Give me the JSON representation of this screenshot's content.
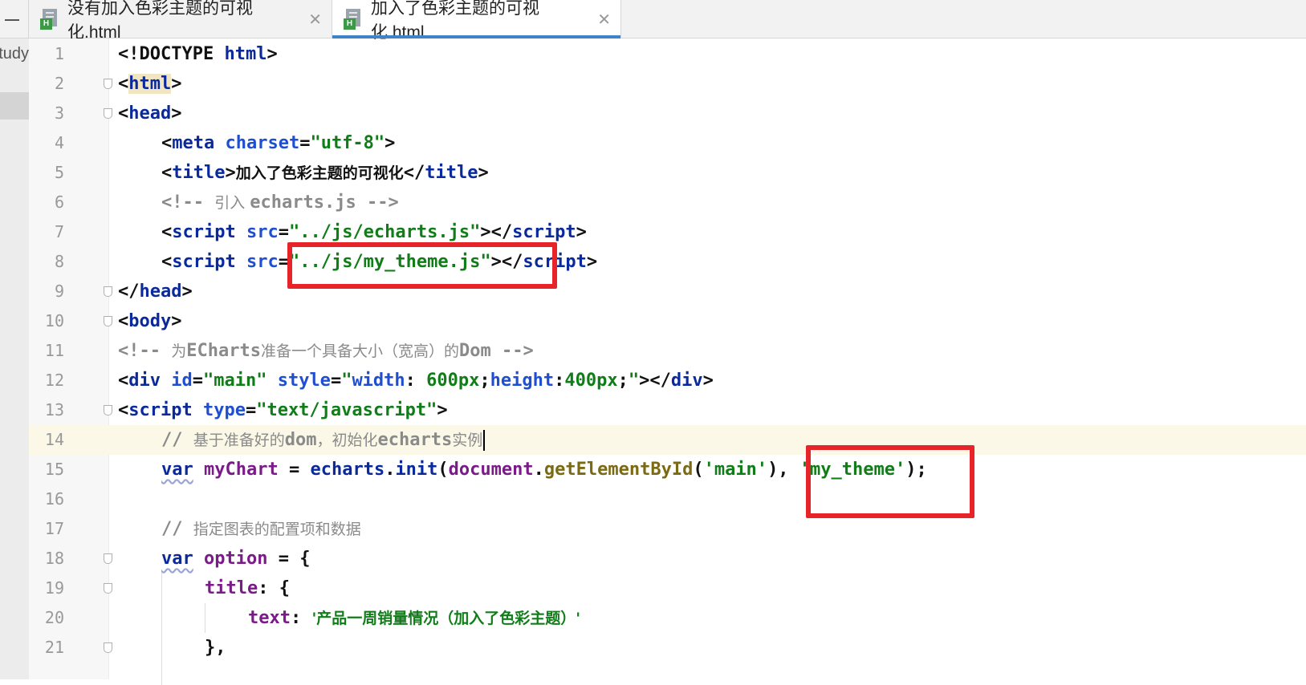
{
  "tabs": [
    {
      "label": "没有加入色彩主题的可视化.html",
      "close": "✕",
      "active": false,
      "icon": "html-file-icon"
    },
    {
      "label": "加入了色彩主题的可视化.html",
      "close": "✕",
      "active": true,
      "icon": "html-file-icon"
    }
  ],
  "project_label": "study",
  "highlight_color": "#e8242b",
  "lines": [
    {
      "n": "1",
      "tokens": [
        [
          "<!DOCTYPE ",
          "plain"
        ],
        [
          "html",
          "tag"
        ],
        [
          ">",
          "plain"
        ]
      ]
    },
    {
      "n": "2",
      "tokens": [
        [
          "<",
          "plain"
        ],
        [
          "html",
          "tag tag-hl"
        ],
        [
          ">",
          "plain"
        ]
      ]
    },
    {
      "n": "3",
      "tokens": [
        [
          "<",
          "plain"
        ],
        [
          "head",
          "tag"
        ],
        [
          ">",
          "plain"
        ]
      ]
    },
    {
      "n": "4",
      "tokens": [
        [
          "<",
          "plain"
        ],
        [
          "meta ",
          "tag"
        ],
        [
          "charset",
          "attr"
        ],
        [
          "=",
          "plain"
        ],
        [
          "\"utf-8\"",
          "str"
        ],
        [
          ">",
          "plain"
        ]
      ]
    },
    {
      "n": "5",
      "tokens": [
        [
          "<",
          "plain"
        ],
        [
          "title",
          "tag"
        ],
        [
          ">",
          "plain"
        ],
        [
          "加入了色彩主题的可视化",
          "plain cn"
        ],
        [
          "</",
          "plain"
        ],
        [
          "title",
          "tag"
        ],
        [
          ">",
          "plain"
        ]
      ]
    },
    {
      "n": "6",
      "tokens": [
        [
          "<!-- ",
          "cmt-bold"
        ],
        [
          "引入 ",
          "cmt cn"
        ],
        [
          "echarts.js -->",
          "cmt-bold"
        ]
      ]
    },
    {
      "n": "7",
      "tokens": [
        [
          "<",
          "plain"
        ],
        [
          "script ",
          "tag"
        ],
        [
          "src",
          "attr"
        ],
        [
          "=",
          "plain"
        ],
        [
          "\"../js/echarts.js\"",
          "str"
        ],
        [
          "></",
          "plain"
        ],
        [
          "script",
          "tag"
        ],
        [
          ">",
          "plain"
        ]
      ]
    },
    {
      "n": "8",
      "tokens": [
        [
          "<",
          "plain"
        ],
        [
          "script ",
          "tag"
        ],
        [
          "src",
          "attr"
        ],
        [
          "=",
          "plain"
        ],
        [
          "\"../js/my_theme.js\"",
          "str"
        ],
        [
          "></",
          "plain"
        ],
        [
          "script",
          "tag"
        ],
        [
          ">",
          "plain"
        ]
      ]
    },
    {
      "n": "9",
      "tokens": [
        [
          "</",
          "plain"
        ],
        [
          "head",
          "tag"
        ],
        [
          ">",
          "plain"
        ]
      ]
    },
    {
      "n": "10",
      "tokens": [
        [
          "<",
          "plain"
        ],
        [
          "body",
          "tag"
        ],
        [
          ">",
          "plain"
        ]
      ]
    },
    {
      "n": "11",
      "tokens": [
        [
          "<!-- ",
          "cmt-bold"
        ],
        [
          "为",
          "cmt cn"
        ],
        [
          "ECharts",
          "cmt-bold"
        ],
        [
          "准备一个具备大小（宽高）的",
          "cmt cn"
        ],
        [
          "Dom -->",
          "cmt-bold"
        ]
      ]
    },
    {
      "n": "12",
      "tokens": [
        [
          "<",
          "plain"
        ],
        [
          "div ",
          "tag"
        ],
        [
          "id",
          "attr"
        ],
        [
          "=",
          "plain"
        ],
        [
          "\"main\" ",
          "str"
        ],
        [
          "style",
          "attr"
        ],
        [
          "=",
          "plain"
        ],
        [
          "\"",
          "str"
        ],
        [
          "width",
          "attr"
        ],
        [
          ": ",
          "plain"
        ],
        [
          "600px",
          "str"
        ],
        [
          ";",
          "plain"
        ],
        [
          "height",
          "attr"
        ],
        [
          ":",
          "plain"
        ],
        [
          "400px",
          "str"
        ],
        [
          ";",
          "plain"
        ],
        [
          "\"",
          "str"
        ],
        [
          "></",
          "plain"
        ],
        [
          "div",
          "tag"
        ],
        [
          ">",
          "plain"
        ]
      ]
    },
    {
      "n": "13",
      "tokens": [
        [
          "<",
          "plain"
        ],
        [
          "script ",
          "tag"
        ],
        [
          "type",
          "attr"
        ],
        [
          "=",
          "plain"
        ],
        [
          "\"text/javascript\"",
          "str"
        ],
        [
          ">",
          "plain"
        ]
      ]
    },
    {
      "n": "14",
      "tokens": [
        [
          "// ",
          "cmt-bold"
        ],
        [
          "基于准备好的",
          "cmt cn"
        ],
        [
          "dom",
          "cmt-bold"
        ],
        [
          "，初始化",
          "cmt cn"
        ],
        [
          "echarts",
          "cmt-bold"
        ],
        [
          "实例",
          "cmt cn"
        ]
      ]
    },
    {
      "n": "15",
      "tokens": [
        [
          "var",
          "kw"
        ],
        [
          " ",
          "plain"
        ],
        [
          "myChart",
          "var"
        ],
        [
          " = ",
          "plain"
        ],
        [
          "echarts",
          "fn"
        ],
        [
          ".",
          "plain"
        ],
        [
          "init",
          "fn"
        ],
        [
          "(",
          "plain"
        ],
        [
          "document",
          "var"
        ],
        [
          ".",
          "plain"
        ],
        [
          "getElementById",
          "call"
        ],
        [
          "(",
          "plain"
        ],
        [
          "'main'",
          "str"
        ],
        [
          "), ",
          "plain"
        ],
        [
          "'my_theme'",
          "str"
        ],
        [
          ");",
          "plain"
        ]
      ]
    },
    {
      "n": "16",
      "tokens": []
    },
    {
      "n": "17",
      "tokens": [
        [
          "// ",
          "cmt-bold"
        ],
        [
          "指定图表的配置项和数据",
          "cmt cn"
        ]
      ]
    },
    {
      "n": "18",
      "tokens": [
        [
          "var",
          "kw"
        ],
        [
          " ",
          "plain"
        ],
        [
          "option",
          "var"
        ],
        [
          " = {",
          "plain"
        ]
      ]
    },
    {
      "n": "19",
      "tokens": [
        [
          "title",
          "key"
        ],
        [
          ": {",
          "plain"
        ]
      ]
    },
    {
      "n": "20",
      "tokens": [
        [
          "text",
          "key"
        ],
        [
          ": ",
          "plain"
        ],
        [
          "'产品一周销量情况（加入了色彩主题）'",
          "str cn"
        ]
      ]
    },
    {
      "n": "21",
      "tokens": [
        [
          "},",
          "plain"
        ]
      ]
    }
  ]
}
